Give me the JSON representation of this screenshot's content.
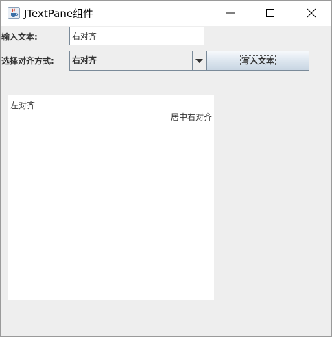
{
  "window": {
    "title": "JTextPane组件",
    "icon": "java-cup-icon",
    "controls": [
      "minimize-icon",
      "maximize-icon",
      "close-icon"
    ]
  },
  "form": {
    "input_label": "输入文本:",
    "input_value": "右对齐",
    "align_label": "选择对齐方式:",
    "align_selected": "右对齐",
    "write_button": "写入文本"
  },
  "text_pane": {
    "lines": [
      {
        "text": "左对齐",
        "align": "left"
      },
      {
        "text": "居中右对齐",
        "align": "right"
      }
    ]
  }
}
